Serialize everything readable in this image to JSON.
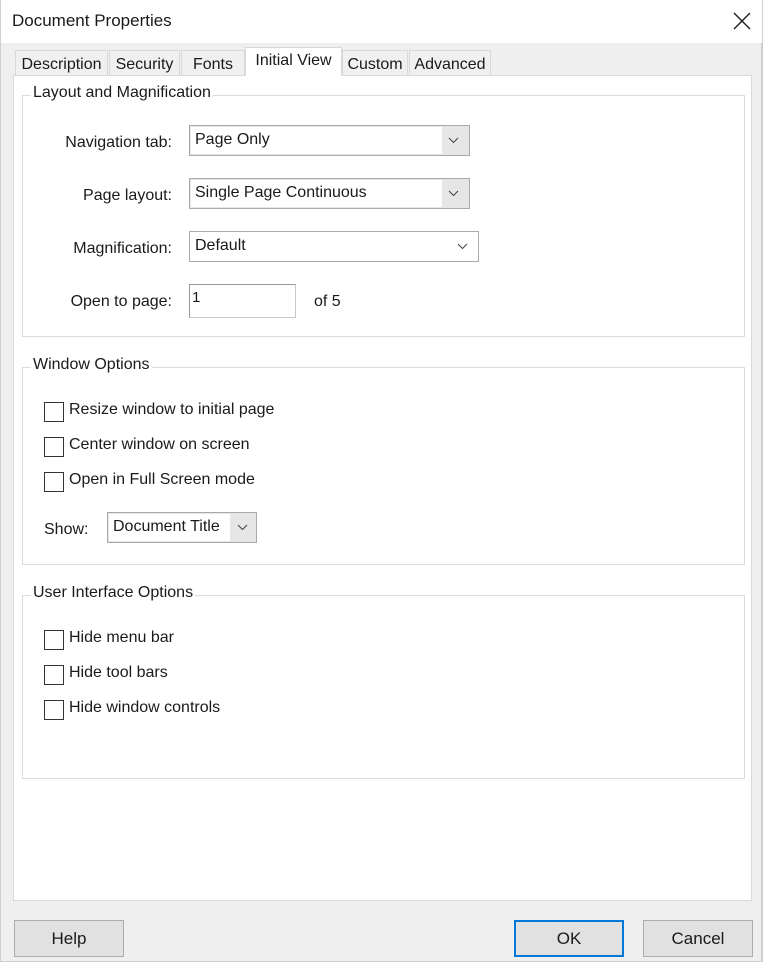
{
  "window": {
    "title": "Document Properties",
    "close_icon": "close-icon"
  },
  "tabs": [
    {
      "label": "Description",
      "active": false
    },
    {
      "label": "Security",
      "active": false
    },
    {
      "label": "Fonts",
      "active": false
    },
    {
      "label": "Initial View",
      "active": true
    },
    {
      "label": "Custom",
      "active": false
    },
    {
      "label": "Advanced",
      "active": false
    }
  ],
  "layout_magnification": {
    "title": "Layout and Magnification",
    "navigation_tab": {
      "label": "Navigation tab:",
      "value": "Page Only"
    },
    "page_layout": {
      "label": "Page layout:",
      "value": "Single Page Continuous"
    },
    "magnification": {
      "label": "Magnification:",
      "value": "Default"
    },
    "open_to_page": {
      "label": "Open to page:",
      "value": "1",
      "of_text": "of 5"
    }
  },
  "window_options": {
    "title": "Window Options",
    "checkboxes": [
      {
        "label": "Resize window to initial page",
        "checked": false
      },
      {
        "label": "Center window on screen",
        "checked": false
      },
      {
        "label": "Open in Full Screen mode",
        "checked": false
      }
    ],
    "show": {
      "label": "Show:",
      "value": "Document Title"
    }
  },
  "ui_options": {
    "title": "User Interface Options",
    "checkboxes": [
      {
        "label": "Hide menu bar",
        "checked": false
      },
      {
        "label": "Hide tool bars",
        "checked": false
      },
      {
        "label": "Hide window controls",
        "checked": false
      }
    ]
  },
  "buttons": {
    "help": "Help",
    "ok": "OK",
    "cancel": "Cancel"
  },
  "colors": {
    "default_button_border": "#0078d7",
    "dialog_background": "#efefef",
    "panel_background": "#ffffff"
  }
}
